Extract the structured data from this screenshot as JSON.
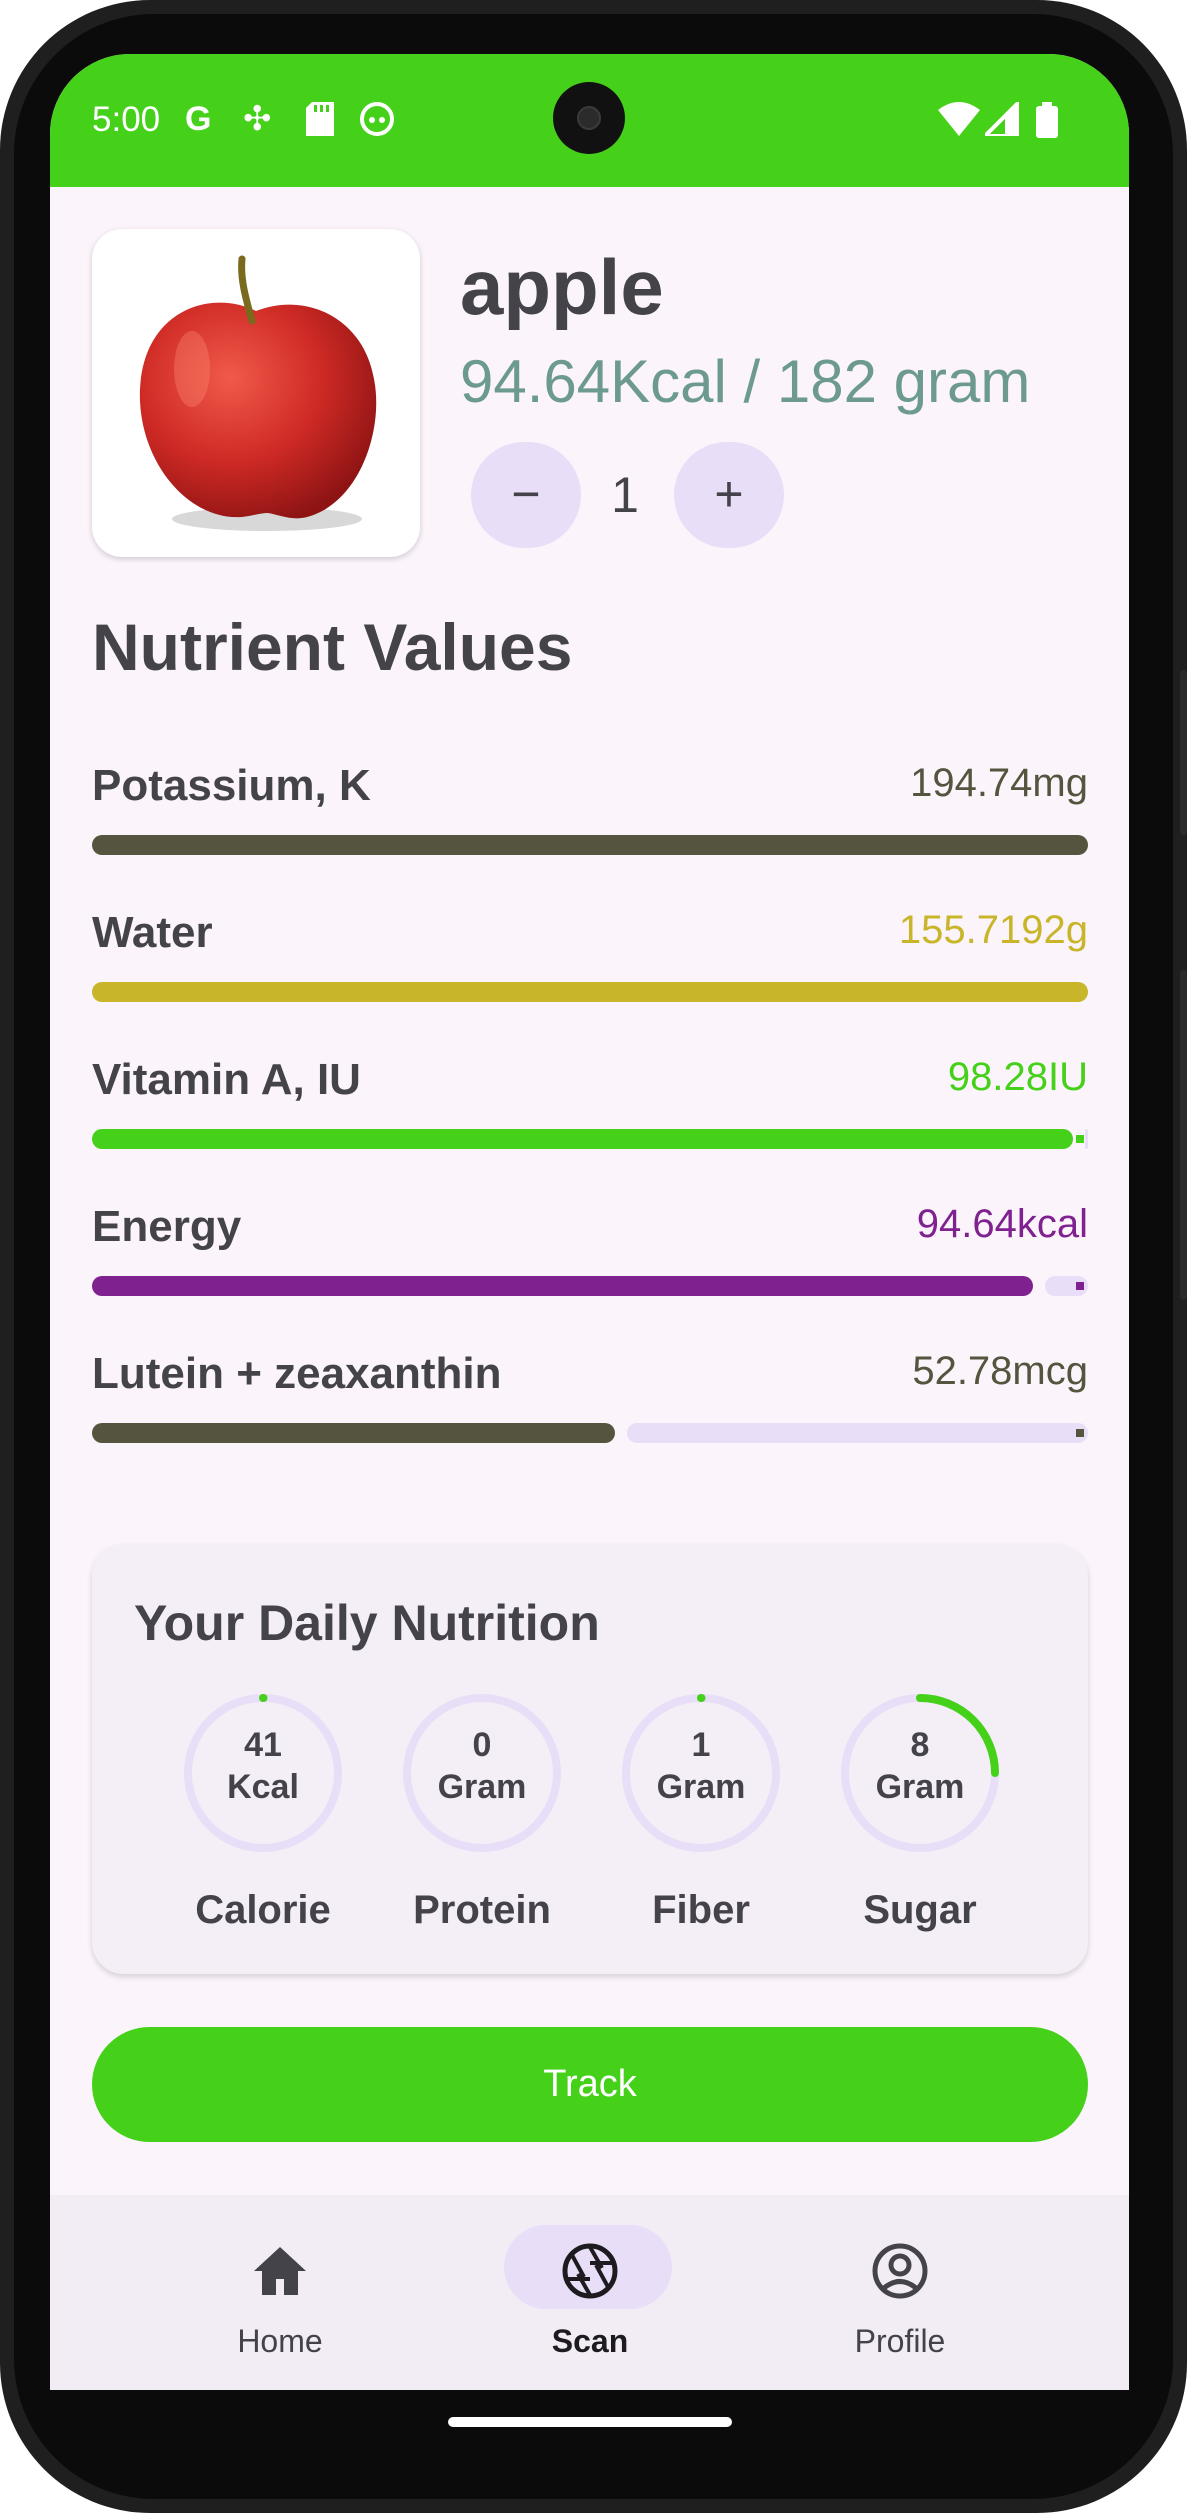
{
  "status_bar": {
    "time": "5:00",
    "left_icons": [
      "google-icon",
      "pinwheel-icon",
      "sd-card-icon",
      "android-face-icon"
    ],
    "right_icons": [
      "wifi-icon",
      "signal-icon",
      "battery-icon"
    ]
  },
  "food": {
    "name": "apple",
    "calories_per_serving": "94.64Kcal / 182 gram",
    "quantity": "1",
    "decrease_label": "−",
    "increase_label": "+"
  },
  "nutrients_section": {
    "title": "Nutrient Values",
    "items": [
      {
        "label": "Potassium, K",
        "value": "194.74mg",
        "fraction": 1.0,
        "color": "#55553f"
      },
      {
        "label": "Water",
        "value": "155.7192g",
        "fraction": 1.0,
        "color": "#c8b52a"
      },
      {
        "label": "Vitamin A, IU",
        "value": "98.28IU",
        "fraction": 0.985,
        "color": "#45d11a"
      },
      {
        "label": "Energy",
        "value": "94.64kcal",
        "fraction": 0.945,
        "color": "#7f2290"
      },
      {
        "label": "Lutein + zeaxanthin",
        "value": "52.78mcg",
        "fraction": 0.525,
        "color": "#55553f"
      }
    ]
  },
  "daily_nutrition": {
    "title": "Your Daily Nutrition",
    "items": [
      {
        "value": "41",
        "unit": "Kcal",
        "label": "Calorie",
        "progress": 0.01
      },
      {
        "value": "0",
        "unit": "Gram",
        "label": "Protein",
        "progress": 0
      },
      {
        "value": "1",
        "unit": "Gram",
        "label": "Fiber",
        "progress": 0.01
      },
      {
        "value": "8",
        "unit": "Gram",
        "label": "Sugar",
        "progress": 0.25
      }
    ],
    "accent_color": "#45d11a"
  },
  "track_button": {
    "label": "Track"
  },
  "bottom_nav": {
    "items": [
      {
        "label": "Home",
        "icon": "home-icon",
        "active": false
      },
      {
        "label": "Scan",
        "icon": "camera-aperture-icon",
        "active": true
      },
      {
        "label": "Profile",
        "icon": "account-circle-icon",
        "active": false
      }
    ]
  }
}
